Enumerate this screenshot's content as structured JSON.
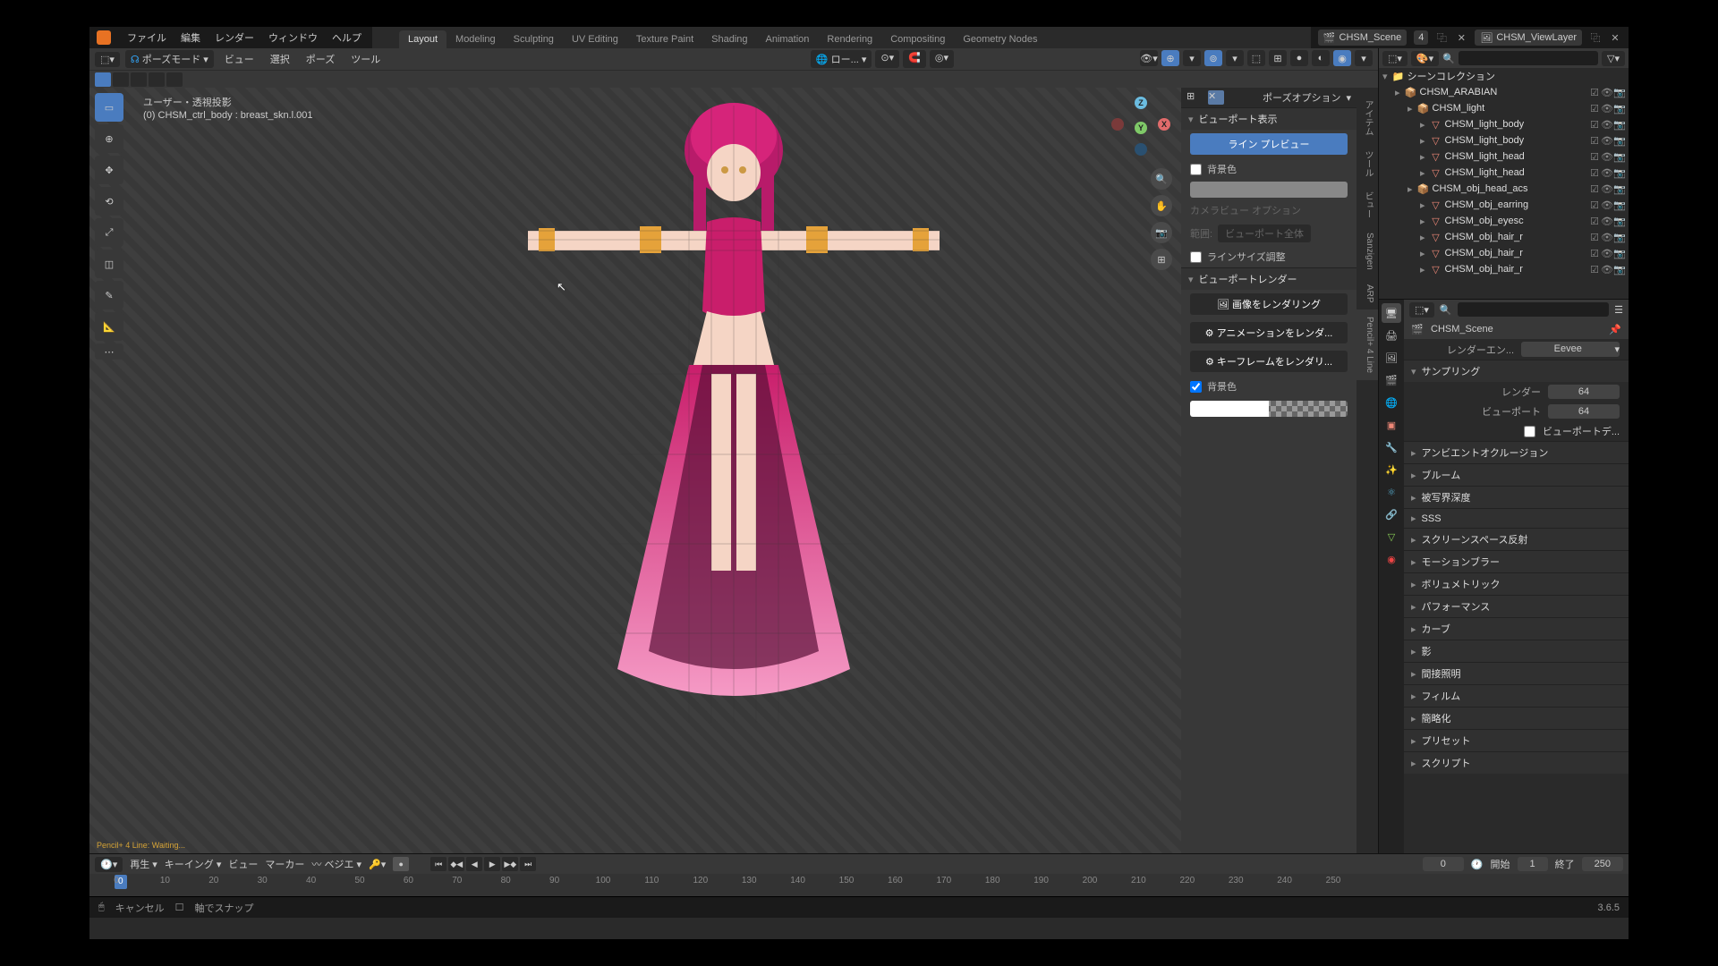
{
  "topbar": {
    "menus": [
      "ファイル",
      "編集",
      "レンダー",
      "ウィンドウ",
      "ヘルプ"
    ],
    "scene_label": "CHSM_Scene",
    "scene_count": "4",
    "viewlayer_label": "CHSM_ViewLayer"
  },
  "workspaces": [
    "Layout",
    "Modeling",
    "Sculpting",
    "UV Editing",
    "Texture Paint",
    "Shading",
    "Animation",
    "Rendering",
    "Compositing",
    "Geometry Nodes"
  ],
  "workspace_active": "Layout",
  "viewport_header": {
    "mode": "ポーズモード",
    "menus": [
      "ビュー",
      "選択",
      "ポーズ",
      "ツール"
    ],
    "pivot_label": "ロー..."
  },
  "overlay": {
    "line1": "ユーザー・透視投影",
    "line2": "(0) CHSM_ctrl_body : breast_skn.l.001"
  },
  "n_panel": {
    "options_label": "ポーズオプション",
    "sections": {
      "viewport_disp": "ビューポート表示",
      "line_preview": "ライン プレビュー",
      "bg_color": "背景色",
      "camview_opt": "カメラビュー オプション",
      "range": "範囲:",
      "range_val": "ビューポート全体",
      "line_size": "ラインサイズ調整",
      "viewport_render": "ビューポートレンダー",
      "render_image": "画像をレンダリング",
      "render_anim": "アニメーションをレンダ...",
      "render_keyframe": "キーフレームをレンダリ...",
      "bg_color2": "背景色"
    },
    "tabs": [
      "アイテム",
      "ツール",
      "ビュー",
      "Sanzigen",
      "ARP",
      "Pencil+ 4 Line"
    ]
  },
  "outliner": {
    "root": "シーンコレクション",
    "items": [
      {
        "depth": 1,
        "icon": "collection",
        "name": "CHSM_ARABIAN",
        "toggles": 3
      },
      {
        "depth": 2,
        "icon": "collection-y",
        "name": "CHSM_light",
        "toggles": 3
      },
      {
        "depth": 3,
        "icon": "mesh",
        "name": "CHSM_light_body",
        "toggles": 3
      },
      {
        "depth": 3,
        "icon": "mesh",
        "name": "CHSM_light_body",
        "toggles": 3
      },
      {
        "depth": 3,
        "icon": "mesh",
        "name": "CHSM_light_head",
        "toggles": 3
      },
      {
        "depth": 3,
        "icon": "mesh",
        "name": "CHSM_light_head",
        "toggles": 3
      },
      {
        "depth": 2,
        "icon": "collection-r",
        "name": "CHSM_obj_head_acs",
        "toggles": 3
      },
      {
        "depth": 3,
        "icon": "mesh",
        "name": "CHSM_obj_earring",
        "toggles": 3
      },
      {
        "depth": 3,
        "icon": "mesh",
        "name": "CHSM_obj_eyesc",
        "toggles": 3
      },
      {
        "depth": 3,
        "icon": "mesh",
        "name": "CHSM_obj_hair_r",
        "toggles": 3
      },
      {
        "depth": 3,
        "icon": "mesh",
        "name": "CHSM_obj_hair_r",
        "toggles": 3
      },
      {
        "depth": 3,
        "icon": "mesh",
        "name": "CHSM_obj_hair_r",
        "toggles": 3
      }
    ]
  },
  "properties": {
    "scene_name": "CHSM_Scene",
    "render_engine_label": "レンダーエン...",
    "render_engine": "Eevee",
    "sampling": "サンプリング",
    "render_label": "レンダー",
    "render_val": "64",
    "viewport_label": "ビューポート",
    "viewport_val": "64",
    "viewport_denoise": "ビューポートデ...",
    "panels": [
      "アンビエントオクルージョン",
      "ブルーム",
      "被写界深度",
      "SSS",
      "スクリーンスペース反射",
      "モーションブラー",
      "ボリュメトリック",
      "パフォーマンス",
      "カーブ",
      "影",
      "間接照明",
      "フィルム",
      "簡略化",
      "プリセット",
      "スクリプト"
    ]
  },
  "timeline": {
    "menus": [
      "再生",
      "キーイング",
      "ビュー",
      "マーカー",
      "ベジエ"
    ],
    "current": "0",
    "start_label": "開始",
    "start": "1",
    "end_label": "終了",
    "end": "250",
    "frames": [
      "0",
      "10",
      "20",
      "30",
      "40",
      "50",
      "60",
      "70",
      "80",
      "90",
      "100",
      "110",
      "120",
      "130",
      "140",
      "150",
      "160",
      "170",
      "180",
      "190",
      "200",
      "210",
      "220",
      "230",
      "240",
      "250"
    ]
  },
  "statusbar": {
    "cancel": "キャンセル",
    "snap": "軸でスナップ",
    "version": "3.6.5"
  },
  "waiting": "Pencil+ 4 Line: Waiting..."
}
